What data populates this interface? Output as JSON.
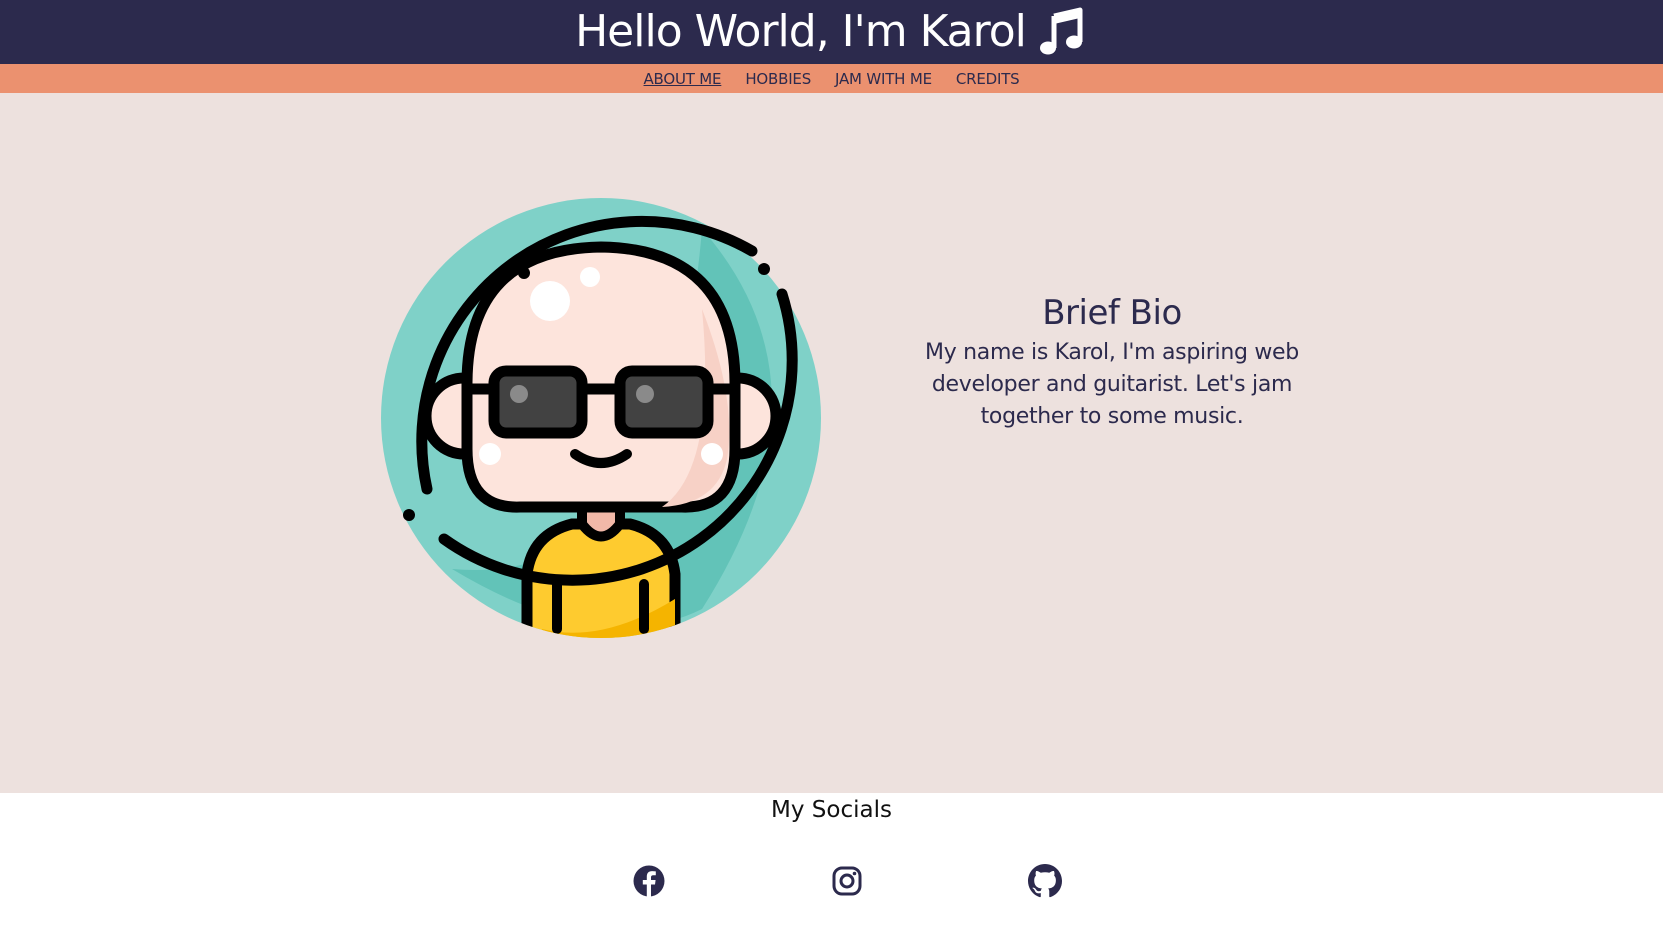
{
  "header": {
    "title": "Hello World, I'm Karol",
    "icon": "music-note-icon",
    "background": "#2c2a4d"
  },
  "nav": {
    "background": "#eb916f",
    "items": [
      {
        "label": "ABOUT ME",
        "active": true
      },
      {
        "label": "HOBBIES",
        "active": false
      },
      {
        "label": "JAM WITH ME",
        "active": false
      },
      {
        "label": "CREDITS",
        "active": false
      }
    ]
  },
  "main": {
    "background": "#ede1de",
    "avatar": "avatar-bald-sunglasses-icon",
    "bio": {
      "heading": "Brief Bio",
      "text": "My name is Karol, I'm aspiring web developer and guitarist. Let's jam together to some music."
    }
  },
  "footer": {
    "heading": "My Socials",
    "links": [
      {
        "icon": "facebook-icon"
      },
      {
        "icon": "instagram-icon"
      },
      {
        "icon": "github-icon"
      }
    ]
  }
}
